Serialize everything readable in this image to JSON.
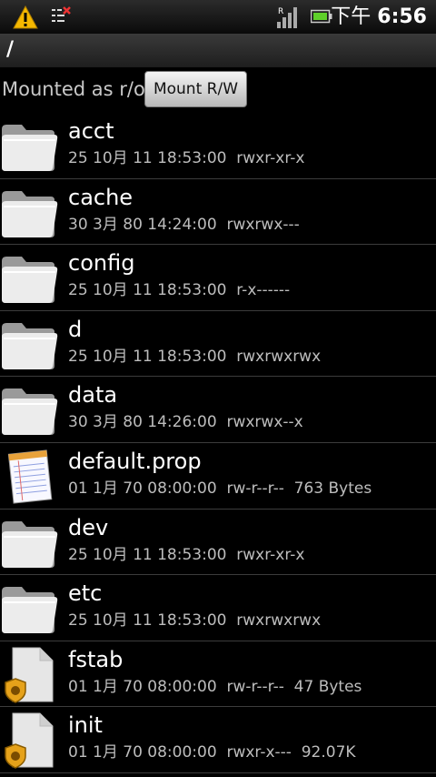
{
  "status_bar": {
    "time_prefix": "下午",
    "time": "6:56",
    "icons": [
      "warning-icon",
      "notification-icon",
      "signal-icon",
      "battery-icon"
    ]
  },
  "path": "/",
  "mount": {
    "status_label": "Mounted as r/o",
    "button_label": "Mount R/W"
  },
  "files": [
    {
      "name": "acct",
      "date": "25 10月 11 18:53:00",
      "perms": "rwxr-xr-x",
      "size": "",
      "icon": "folder-icon"
    },
    {
      "name": "cache",
      "date": "30 3月 80 14:24:00",
      "perms": "rwxrwx---",
      "size": "",
      "icon": "folder-icon"
    },
    {
      "name": "config",
      "date": "25 10月 11 18:53:00",
      "perms": "r-x------",
      "size": "",
      "icon": "folder-icon"
    },
    {
      "name": "d",
      "date": "25 10月 11 18:53:00",
      "perms": "rwxrwxrwx",
      "size": "",
      "icon": "folder-icon"
    },
    {
      "name": "data",
      "date": "30 3月 80 14:26:00",
      "perms": "rwxrwx--x",
      "size": "",
      "icon": "folder-icon"
    },
    {
      "name": "default.prop",
      "date": "01 1月 70 08:00:00",
      "perms": "rw-r--r--",
      "size": "763 Bytes",
      "icon": "text-file-icon"
    },
    {
      "name": "dev",
      "date": "25 10月 11 18:53:00",
      "perms": "rwxr-xr-x",
      "size": "",
      "icon": "folder-icon"
    },
    {
      "name": "etc",
      "date": "25 10月 11 18:53:00",
      "perms": "rwxrwxrwx",
      "size": "",
      "icon": "folder-icon"
    },
    {
      "name": "fstab",
      "date": "01 1月 70 08:00:00",
      "perms": "rw-r--r--",
      "size": "47 Bytes",
      "icon": "system-file-icon"
    },
    {
      "name": "init",
      "date": "01 1月 70 08:00:00",
      "perms": "rwxr-x---",
      "size": "92.07K",
      "icon": "system-file-icon"
    }
  ]
}
